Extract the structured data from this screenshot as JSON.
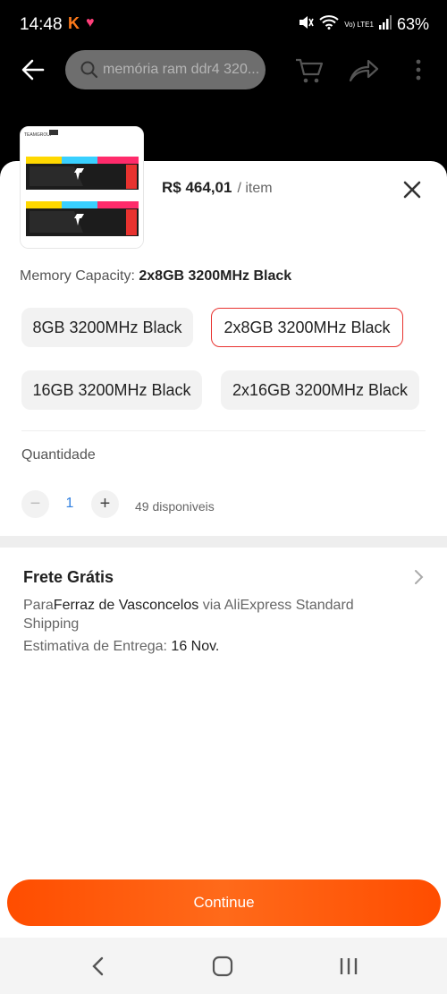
{
  "status_bar": {
    "time": "14:48",
    "battery": "63%",
    "network": "Vo) LTE1"
  },
  "toolbar": {
    "search_placeholder": "memória ram ddr4 320..."
  },
  "product": {
    "price": "R$ 464,01",
    "per_item": "/ item"
  },
  "memory": {
    "label": "Memory Capacity:",
    "selected": "2x8GB 3200MHz Black",
    "options": [
      "8GB 3200MHz Black",
      "2x8GB 3200MHz Black",
      "16GB 3200MHz Black",
      "2x16GB 3200MHz Black"
    ],
    "selected_index": 1
  },
  "quantity": {
    "label": "Quantidade",
    "value": "1",
    "available": "49 disponiveis"
  },
  "shipping": {
    "title": "Frete Grátis",
    "prefix": "Para",
    "destination": "Ferraz de Vasconcelos",
    "via": " via AliExpress Standard Shipping",
    "eta_label": "Estimativa de Entrega: ",
    "eta_date": "16 Nov."
  },
  "continue_label": "Continue",
  "colors": {
    "accent": "#ff5a0a",
    "selected_border": "#e8322f",
    "qty_value": "#2f7fe0"
  }
}
